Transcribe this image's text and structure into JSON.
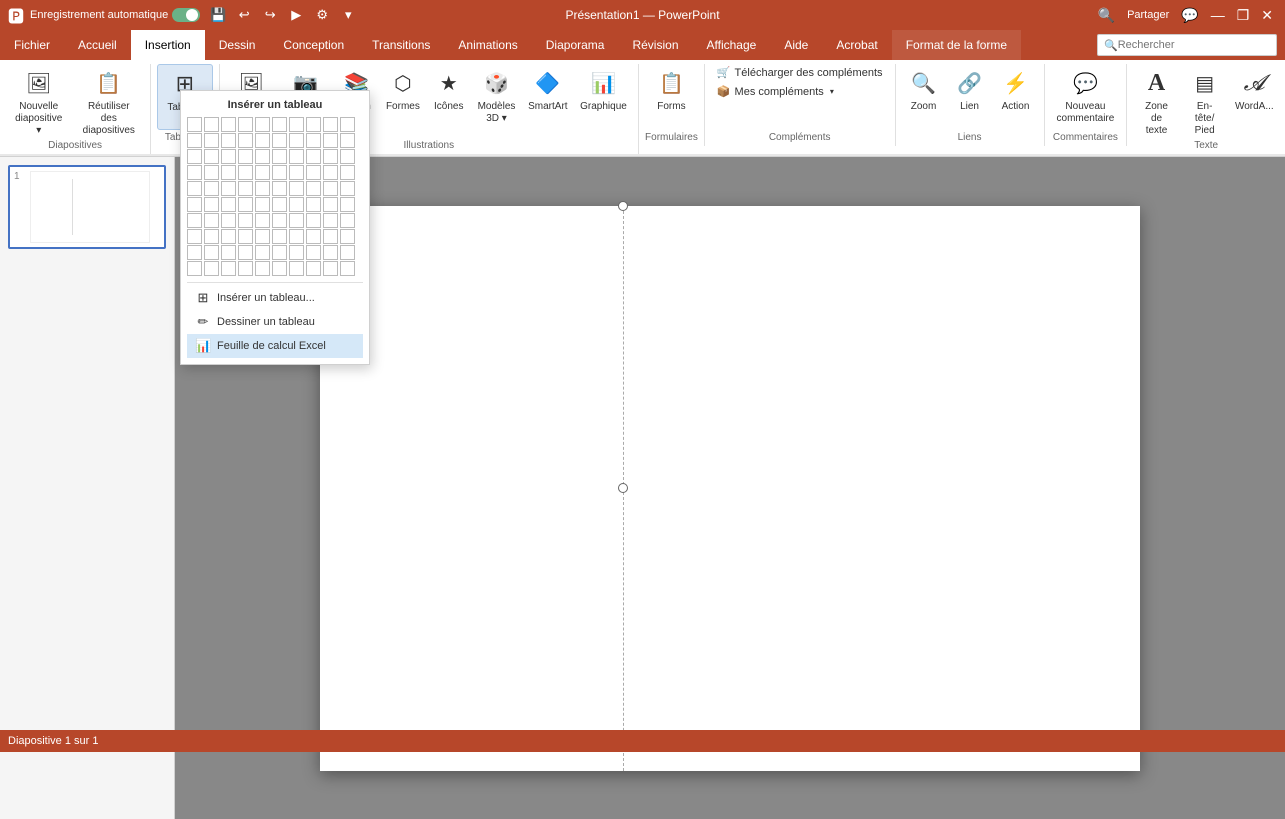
{
  "titlebar": {
    "autosave_label": "Enregistrement automatique",
    "autosave_on": true,
    "filename": "Présentation1",
    "app": "PowerPoint",
    "title_full": "Présentation1 — PowerPoint",
    "search_placeholder": "Rechercher",
    "qs_buttons": [
      "💾",
      "↩",
      "↪",
      "▶",
      "⚙",
      "▾"
    ]
  },
  "tabs": [
    {
      "id": "fichier",
      "label": "Fichier"
    },
    {
      "id": "accueil",
      "label": "Accueil"
    },
    {
      "id": "insertion",
      "label": "Insertion",
      "active": true
    },
    {
      "id": "dessin",
      "label": "Dessin"
    },
    {
      "id": "conception",
      "label": "Conception"
    },
    {
      "id": "transitions",
      "label": "Transitions"
    },
    {
      "id": "animations",
      "label": "Animations"
    },
    {
      "id": "diaporama",
      "label": "Diaporama"
    },
    {
      "id": "revision",
      "label": "Révision"
    },
    {
      "id": "affichage",
      "label": "Affichage"
    },
    {
      "id": "aide",
      "label": "Aide"
    },
    {
      "id": "acrobat",
      "label": "Acrobat"
    },
    {
      "id": "format",
      "label": "Format de la forme",
      "accent": true
    }
  ],
  "ribbon": {
    "groups": [
      {
        "id": "diapositives",
        "label": "Diapositives",
        "items": [
          {
            "id": "nouvelle-diapositive",
            "label": "Nouvelle\ndiapositive",
            "icon": "🖼",
            "dropdown": true
          },
          {
            "id": "reutiliser",
            "label": "Réutiliser des\ndiapositives",
            "icon": "📋"
          }
        ]
      },
      {
        "id": "tableaux",
        "label": "Tableaux",
        "items": [
          {
            "id": "tableau",
            "label": "Tableau",
            "icon": "⊞",
            "dropdown": true,
            "active": true
          }
        ]
      },
      {
        "id": "illustrations",
        "label": "Illustrations",
        "items": [
          {
            "id": "images",
            "label": "Images",
            "icon": "🖼",
            "dropdown": true
          },
          {
            "id": "capture",
            "label": "Capture",
            "icon": "📷",
            "dropdown": true
          },
          {
            "id": "album-photo",
            "label": "Album\nphoto",
            "icon": "📚",
            "dropdown": true
          },
          {
            "id": "formes",
            "label": "Formes",
            "icon": "⬡"
          },
          {
            "id": "icones",
            "label": "Icônes",
            "icon": "★"
          },
          {
            "id": "modeles-3d",
            "label": "Modèles\n3D",
            "icon": "🎲",
            "dropdown": true
          },
          {
            "id": "smartart",
            "label": "SmartArt",
            "icon": "🔷"
          },
          {
            "id": "graphique",
            "label": "Graphique",
            "icon": "📊"
          }
        ]
      },
      {
        "id": "formulaires",
        "label": "Formulaires",
        "items": [
          {
            "id": "forms",
            "label": "Forms",
            "icon": "📋"
          }
        ]
      },
      {
        "id": "complements",
        "label": "Compléments",
        "items": [
          {
            "id": "telecharger-complements",
            "label": "Télécharger des compléments",
            "icon": "🛒"
          },
          {
            "id": "mes-complements",
            "label": "Mes compléments",
            "icon": "📦",
            "dropdown": true
          }
        ]
      },
      {
        "id": "liens",
        "label": "Liens",
        "items": [
          {
            "id": "zoom-lien",
            "label": "Zoom",
            "icon": "🔍"
          },
          {
            "id": "lien",
            "label": "Lien",
            "icon": "🔗"
          },
          {
            "id": "action",
            "label": "Action",
            "icon": "⚡"
          }
        ]
      },
      {
        "id": "commentaires",
        "label": "Commentaires",
        "items": [
          {
            "id": "nouveau-commentaire",
            "label": "Nouveau\ncommentaire",
            "icon": "💬"
          }
        ]
      },
      {
        "id": "texte-group",
        "label": "Texte",
        "items": [
          {
            "id": "zone-de-texte",
            "label": "Zone\nde texte",
            "icon": "A"
          },
          {
            "id": "entete-pied",
            "label": "En-tête/\nPied",
            "icon": "▤"
          },
          {
            "id": "wordart",
            "label": "WordA...",
            "icon": "𝓐"
          }
        ]
      }
    ]
  },
  "table_popup": {
    "title": "Insérer un tableau",
    "grid_rows": 10,
    "grid_cols": 10,
    "menu_items": [
      {
        "id": "inserer-tableau",
        "label": "Insérer un tableau...",
        "icon": "⊞"
      },
      {
        "id": "dessiner-tableau",
        "label": "Dessiner un tableau",
        "icon": "✏"
      },
      {
        "id": "feuille-excel",
        "label": "Feuille de calcul Excel",
        "icon": "📊",
        "active": true
      }
    ]
  },
  "slides": [
    {
      "num": "1",
      "selected": true
    }
  ],
  "colors": {
    "accent": "#b7472a",
    "tab_active_bg": "#ffffff",
    "ribbon_bg": "#ffffff",
    "sidebar_bg": "#f5f5f5"
  }
}
